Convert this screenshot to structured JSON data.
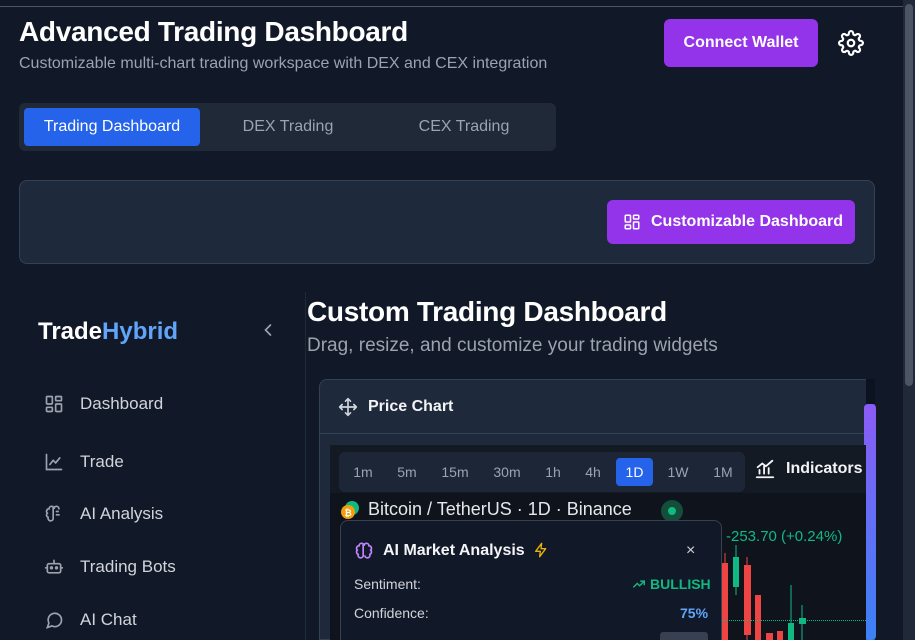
{
  "header": {
    "title": "Advanced Trading Dashboard",
    "subtitle": "Customizable multi-chart trading workspace with DEX and CEX integration",
    "connect_label": "Connect Wallet"
  },
  "tabs": [
    {
      "label": "Trading Dashboard",
      "active": true
    },
    {
      "label": "DEX Trading",
      "active": false
    },
    {
      "label": "CEX Trading",
      "active": false
    }
  ],
  "panel": {
    "customize_label": "Customizable Dashboard"
  },
  "sidebar": {
    "brand_a": "Trade",
    "brand_b": "Hybrid",
    "items": [
      {
        "label": "Dashboard",
        "icon": "grid-icon"
      },
      {
        "label": "Trade",
        "icon": "chart-line-icon"
      },
      {
        "label": "AI Analysis",
        "icon": "brain-icon"
      },
      {
        "label": "Trading Bots",
        "icon": "bot-icon"
      },
      {
        "label": "AI Chat",
        "icon": "chat-icon"
      }
    ]
  },
  "main": {
    "title": "Custom Trading Dashboard",
    "subtitle": "Drag, resize, and customize your trading widgets"
  },
  "widget": {
    "title": "Price Chart",
    "timeframes": [
      "1m",
      "5m",
      "15m",
      "30m",
      "1h",
      "4h",
      "1D",
      "1W",
      "1M"
    ],
    "active_timeframe": "1D",
    "indicators_label": "Indicators",
    "symbol": "Bitcoin / TetherUS · 1D · Binance",
    "price_change": "-253.70 (+0.24%)"
  },
  "ai": {
    "title": "AI Market Analysis",
    "sentiment_label": "Sentiment:",
    "sentiment_value": "BULLISH",
    "confidence_label": "Confidence:",
    "confidence_value": "75%",
    "close": "×"
  },
  "colors": {
    "bg": "#111827",
    "purple": "#9333ea",
    "blue": "#2563eb",
    "green": "#10b981",
    "red": "#ef4444"
  }
}
